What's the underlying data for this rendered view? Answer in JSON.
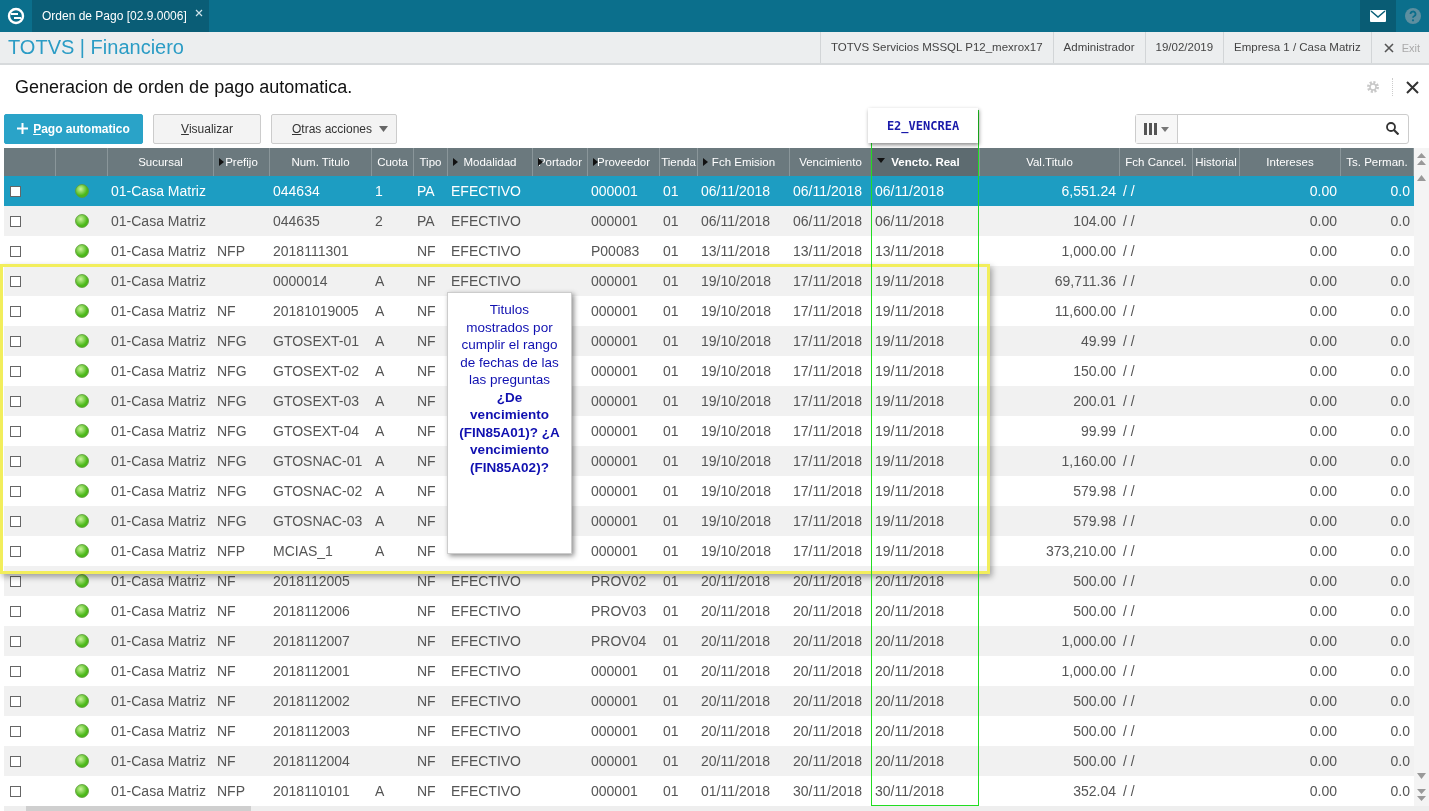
{
  "top_bar": {
    "tab": {
      "label": "Orden de Pago [02.9.0006]",
      "selected": true
    }
  },
  "header": {
    "brand": "TOTVS | Financiero",
    "info": [
      "TOTVS Servicios MSSQL P12_mexrox17",
      "Administrador",
      "19/02/2019",
      "Empresa 1 / Casa Matriz"
    ],
    "exit": "Exit"
  },
  "page": {
    "title": "Generacion de orden de pago automatica."
  },
  "toolbar": {
    "buttons": [
      {
        "label": "Pago automatico",
        "kind": "primary"
      },
      {
        "label": "Visualizar",
        "kind": "plain"
      },
      {
        "label": "Otras acciones",
        "kind": "menu"
      }
    ]
  },
  "field_label": "E2_VENCREA",
  "callout": "Titulos mostrados por cumplir el rango de fechas de las las preguntas **¿De vencimiento (FIN85A01)?** **¿A vencimiento (FIN85A02)?**",
  "table": {
    "columns": [
      {
        "kind": "checkbox"
      },
      {
        "kind": "status"
      },
      {
        "label": "Sucursal",
        "kind": "text"
      },
      {
        "label": "Prefijo",
        "kind": "filter"
      },
      {
        "label": "Num. Titulo",
        "kind": "text"
      },
      {
        "label": "Cuota",
        "kind": "text"
      },
      {
        "label": "Tipo",
        "kind": "text"
      },
      {
        "label": "Modalidad",
        "kind": "filter"
      },
      {
        "label": "Portador",
        "kind": "filter"
      },
      {
        "label": "Proveedor",
        "kind": "filter"
      },
      {
        "label": "Tienda",
        "kind": "text"
      },
      {
        "label": "Fch Emision",
        "kind": "filter"
      },
      {
        "label": "Vencimiento",
        "kind": "text"
      },
      {
        "label": "Vencto. Real",
        "kind": "sorted"
      },
      {
        "label": "Val.Titulo",
        "kind": "text"
      },
      {
        "label": "Fch Cancel.",
        "kind": "text"
      },
      {
        "label": "Historial",
        "kind": "text"
      },
      {
        "label": "Intereses",
        "kind": "text"
      },
      {
        "label": "Ts. Perman.",
        "kind": "text"
      }
    ],
    "rows": [
      {
        "selected": true,
        "checked": false,
        "sucursal": "01-Casa Matriz",
        "num_titulo": "044634",
        "cuota": "1",
        "tipo": "PA",
        "modalidad": "EFECTIVO",
        "proveedor": "000001",
        "tienda": "01",
        "fch_emision": "06/11/2018",
        "vencimiento": "06/11/2018",
        "vencto_real": "06/11/2018",
        "val_titulo": "6,551.24",
        "fch_cancel": "/  /",
        "intereses": "0.00",
        "ts_perman": "0.0"
      },
      {
        "selected": false,
        "checked": false,
        "sucursal": "01-Casa Matriz",
        "num_titulo": "044635",
        "cuota": "2",
        "tipo": "PA",
        "modalidad": "EFECTIVO",
        "proveedor": "000001",
        "tienda": "01",
        "fch_emision": "06/11/2018",
        "vencimiento": "06/11/2018",
        "vencto_real": "06/11/2018",
        "val_titulo": "104.00",
        "fch_cancel": "/  /",
        "intereses": "0.00",
        "ts_perman": "0.0"
      },
      {
        "selected": false,
        "checked": false,
        "sucursal": "01-Casa Matriz",
        "prefijo": "NFP",
        "num_titulo": "2018111301",
        "tipo": "NF",
        "modalidad": "EFECTIVO",
        "proveedor": "P00083",
        "tienda": "01",
        "fch_emision": "13/11/2018",
        "vencimiento": "13/11/2018",
        "vencto_real": "13/11/2018",
        "val_titulo": "1,000.00",
        "fch_cancel": "/  /",
        "intereses": "0.00",
        "ts_perman": "0.0"
      },
      {
        "selected": false,
        "checked": false,
        "sucursal": "01-Casa Matriz",
        "num_titulo": "0000014",
        "cuota": "A",
        "tipo": "NF",
        "modalidad": "EFECTIVO",
        "proveedor": "000001",
        "tienda": "01",
        "fch_emision": "19/10/2018",
        "vencimiento": "17/11/2018",
        "vencto_real": "19/11/2018",
        "val_titulo": "69,711.36",
        "fch_cancel": "/  /",
        "intereses": "0.00",
        "ts_perman": "0.0"
      },
      {
        "selected": false,
        "checked": false,
        "sucursal": "01-Casa Matriz",
        "prefijo": "NF",
        "num_titulo": "20181019005",
        "cuota": "A",
        "tipo": "NF",
        "proveedor": "000001",
        "tienda": "01",
        "fch_emision": "19/10/2018",
        "vencimiento": "17/11/2018",
        "vencto_real": "19/11/2018",
        "val_titulo": "11,600.00",
        "fch_cancel": "/  /",
        "intereses": "0.00",
        "ts_perman": "0.0"
      },
      {
        "selected": false,
        "checked": false,
        "sucursal": "01-Casa Matriz",
        "prefijo": "NFG",
        "num_titulo": "GTOSEXT-01",
        "cuota": "A",
        "tipo": "NF",
        "proveedor": "000001",
        "tienda": "01",
        "fch_emision": "19/10/2018",
        "vencimiento": "17/11/2018",
        "vencto_real": "19/11/2018",
        "val_titulo": "49.99",
        "fch_cancel": "/  /",
        "intereses": "0.00",
        "ts_perman": "0.0"
      },
      {
        "selected": false,
        "checked": false,
        "sucursal": "01-Casa Matriz",
        "prefijo": "NFG",
        "num_titulo": "GTOSEXT-02",
        "cuota": "A",
        "tipo": "NF",
        "proveedor": "000001",
        "tienda": "01",
        "fch_emision": "19/10/2018",
        "vencimiento": "17/11/2018",
        "vencto_real": "19/11/2018",
        "val_titulo": "150.00",
        "fch_cancel": "/  /",
        "intereses": "0.00",
        "ts_perman": "0.0"
      },
      {
        "selected": false,
        "checked": false,
        "sucursal": "01-Casa Matriz",
        "prefijo": "NFG",
        "num_titulo": "GTOSEXT-03",
        "cuota": "A",
        "tipo": "NF",
        "proveedor": "000001",
        "tienda": "01",
        "fch_emision": "19/10/2018",
        "vencimiento": "17/11/2018",
        "vencto_real": "19/11/2018",
        "val_titulo": "200.01",
        "fch_cancel": "/  /",
        "intereses": "0.00",
        "ts_perman": "0.0"
      },
      {
        "selected": false,
        "checked": false,
        "sucursal": "01-Casa Matriz",
        "prefijo": "NFG",
        "num_titulo": "GTOSEXT-04",
        "cuota": "A",
        "tipo": "NF",
        "proveedor": "000001",
        "tienda": "01",
        "fch_emision": "19/10/2018",
        "vencimiento": "17/11/2018",
        "vencto_real": "19/11/2018",
        "val_titulo": "99.99",
        "fch_cancel": "/  /",
        "intereses": "0.00",
        "ts_perman": "0.0"
      },
      {
        "selected": false,
        "checked": false,
        "sucursal": "01-Casa Matriz",
        "prefijo": "NFG",
        "num_titulo": "GTOSNAC-01",
        "cuota": "A",
        "tipo": "NF",
        "proveedor": "000001",
        "tienda": "01",
        "fch_emision": "19/10/2018",
        "vencimiento": "17/11/2018",
        "vencto_real": "19/11/2018",
        "val_titulo": "1,160.00",
        "fch_cancel": "/  /",
        "intereses": "0.00",
        "ts_perman": "0.0"
      },
      {
        "selected": false,
        "checked": false,
        "sucursal": "01-Casa Matriz",
        "prefijo": "NFG",
        "num_titulo": "GTOSNAC-02",
        "cuota": "A",
        "tipo": "NF",
        "proveedor": "000001",
        "tienda": "01",
        "fch_emision": "19/10/2018",
        "vencimiento": "17/11/2018",
        "vencto_real": "19/11/2018",
        "val_titulo": "579.98",
        "fch_cancel": "/  /",
        "intereses": "0.00",
        "ts_perman": "0.0"
      },
      {
        "selected": false,
        "checked": false,
        "sucursal": "01-Casa Matriz",
        "prefijo": "NFG",
        "num_titulo": "GTOSNAC-03",
        "cuota": "A",
        "tipo": "NF",
        "proveedor": "000001",
        "tienda": "01",
        "fch_emision": "19/10/2018",
        "vencimiento": "17/11/2018",
        "vencto_real": "19/11/2018",
        "val_titulo": "579.98",
        "fch_cancel": "/  /",
        "intereses": "0.00",
        "ts_perman": "0.0"
      },
      {
        "selected": false,
        "checked": false,
        "sucursal": "01-Casa Matriz",
        "prefijo": "NFP",
        "num_titulo": "MCIAS_1",
        "cuota": "A",
        "tipo": "NF",
        "proveedor": "000001",
        "tienda": "01",
        "fch_emision": "19/10/2018",
        "vencimiento": "17/11/2018",
        "vencto_real": "19/11/2018",
        "val_titulo": "373,210.00",
        "fch_cancel": "/  /",
        "intereses": "0.00",
        "ts_perman": "0.0"
      },
      {
        "selected": false,
        "checked": false,
        "sucursal": "01-Casa Matriz",
        "prefijo": "NF",
        "num_titulo": "2018112005",
        "tipo": "NF",
        "modalidad": "EFECTIVO",
        "proveedor": "PROV02",
        "tienda": "01",
        "fch_emision": "20/11/2018",
        "vencimiento": "20/11/2018",
        "vencto_real": "20/11/2018",
        "val_titulo": "500.00",
        "fch_cancel": "/  /",
        "intereses": "0.00",
        "ts_perman": "0.0"
      },
      {
        "selected": false,
        "checked": false,
        "sucursal": "01-Casa Matriz",
        "prefijo": "NF",
        "num_titulo": "2018112006",
        "tipo": "NF",
        "modalidad": "EFECTIVO",
        "proveedor": "PROV03",
        "tienda": "01",
        "fch_emision": "20/11/2018",
        "vencimiento": "20/11/2018",
        "vencto_real": "20/11/2018",
        "val_titulo": "500.00",
        "fch_cancel": "/  /",
        "intereses": "0.00",
        "ts_perman": "0.0"
      },
      {
        "selected": false,
        "checked": false,
        "sucursal": "01-Casa Matriz",
        "prefijo": "NF",
        "num_titulo": "2018112007",
        "tipo": "NF",
        "modalidad": "EFECTIVO",
        "proveedor": "PROV04",
        "tienda": "01",
        "fch_emision": "20/11/2018",
        "vencimiento": "20/11/2018",
        "vencto_real": "20/11/2018",
        "val_titulo": "1,000.00",
        "fch_cancel": "/  /",
        "intereses": "0.00",
        "ts_perman": "0.0"
      },
      {
        "selected": false,
        "checked": false,
        "sucursal": "01-Casa Matriz",
        "prefijo": "NF",
        "num_titulo": "2018112001",
        "tipo": "NF",
        "modalidad": "EFECTIVO",
        "proveedor": "000001",
        "tienda": "01",
        "fch_emision": "20/11/2018",
        "vencimiento": "20/11/2018",
        "vencto_real": "20/11/2018",
        "val_titulo": "1,000.00",
        "fch_cancel": "/  /",
        "intereses": "0.00",
        "ts_perman": "0.0"
      },
      {
        "selected": false,
        "checked": false,
        "sucursal": "01-Casa Matriz",
        "prefijo": "NF",
        "num_titulo": "2018112002",
        "tipo": "NF",
        "modalidad": "EFECTIVO",
        "proveedor": "000001",
        "tienda": "01",
        "fch_emision": "20/11/2018",
        "vencimiento": "20/11/2018",
        "vencto_real": "20/11/2018",
        "val_titulo": "500.00",
        "fch_cancel": "/  /",
        "intereses": "0.00",
        "ts_perman": "0.0"
      },
      {
        "selected": false,
        "checked": false,
        "sucursal": "01-Casa Matriz",
        "prefijo": "NF",
        "num_titulo": "2018112003",
        "tipo": "NF",
        "modalidad": "EFECTIVO",
        "proveedor": "000001",
        "tienda": "01",
        "fch_emision": "20/11/2018",
        "vencimiento": "20/11/2018",
        "vencto_real": "20/11/2018",
        "val_titulo": "500.00",
        "fch_cancel": "/  /",
        "intereses": "0.00",
        "ts_perman": "0.0"
      },
      {
        "selected": false,
        "checked": false,
        "sucursal": "01-Casa Matriz",
        "prefijo": "NF",
        "num_titulo": "2018112004",
        "tipo": "NF",
        "modalidad": "EFECTIVO",
        "proveedor": "000001",
        "tienda": "01",
        "fch_emision": "20/11/2018",
        "vencimiento": "20/11/2018",
        "vencto_real": "20/11/2018",
        "val_titulo": "500.00",
        "fch_cancel": "/  /",
        "intereses": "0.00",
        "ts_perman": "0.0"
      },
      {
        "selected": false,
        "checked": false,
        "sucursal": "01-Casa Matriz",
        "prefijo": "NFP",
        "num_titulo": "2018110101",
        "cuota": "A",
        "tipo": "NF",
        "modalidad": "EFECTIVO",
        "proveedor": "000001",
        "tienda": "01",
        "fch_emision": "01/11/2018",
        "vencimiento": "30/11/2018",
        "vencto_real": "30/11/2018",
        "val_titulo": "352.04",
        "fch_cancel": "/  /",
        "intereses": "0.00",
        "ts_perman": "0.0"
      }
    ]
  }
}
